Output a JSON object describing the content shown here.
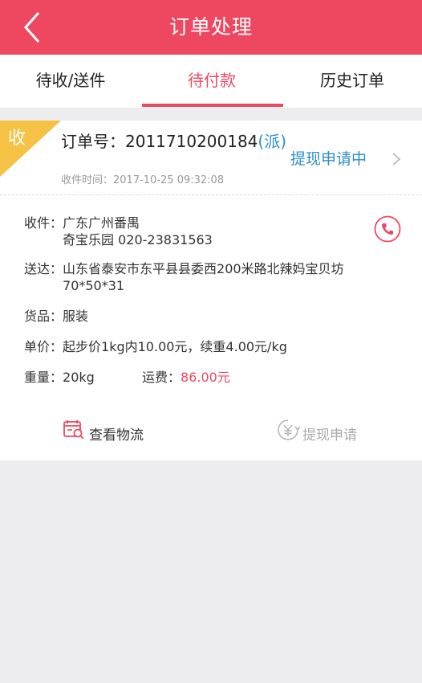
{
  "header": {
    "title": "订单处理"
  },
  "tabs": [
    {
      "label": "待收/送件"
    },
    {
      "label": "待付款"
    },
    {
      "label": "历史订单"
    }
  ],
  "order": {
    "corner_label": "收",
    "number_label": "订单号：",
    "number": "2011710200184",
    "tag": "(派)",
    "time_label": "收件时间：",
    "time": "2017-10-25 09:32:08",
    "status": "提现申请中",
    "pickup_label": "收件：",
    "pickup_line1": "广东广州番禺",
    "pickup_line2": "奇宝乐园 020-23831563",
    "deliver_label": "送达：",
    "deliver_line1": "山东省泰安市东平县县委西200米路北辣妈宝贝坊",
    "deliver_line2": "70*50*31",
    "goods_label": "货品：",
    "goods": "服装",
    "price_label": "单价：",
    "price": "起步价1kg内10.00元，续重4.00元/kg",
    "weight_label": "重量：",
    "weight": "20kg",
    "fee_label": "运费：",
    "fee": "86.00元"
  },
  "actions": {
    "logistics": "查看物流",
    "withdraw": "提现申请"
  },
  "colors": {
    "brand": "#ee4861",
    "link": "#2e8ec9",
    "corner": "#f5c245"
  }
}
